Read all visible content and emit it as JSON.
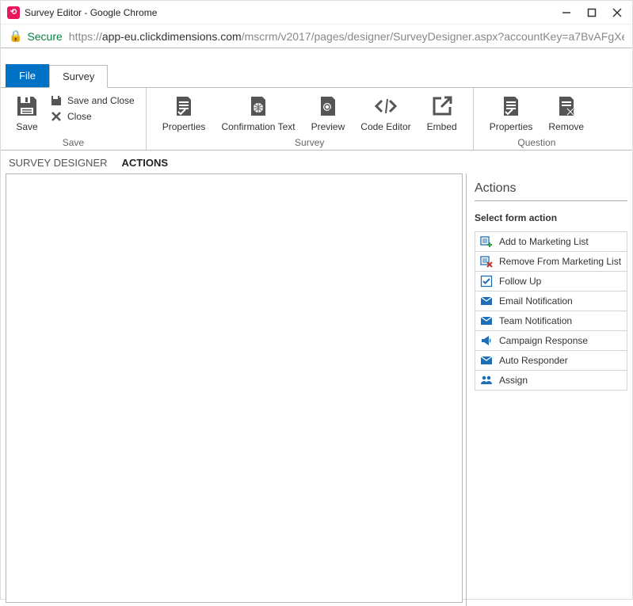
{
  "window": {
    "title": "Survey Editor - Google Chrome",
    "secure_label": "Secure",
    "url_prefix": "https://",
    "url_domain": "app-eu.clickdimensions.com",
    "url_path": "/mscrm/v2017/pages/designer/SurveyDesigner.aspx?accountKey=a7BvAFgXe..."
  },
  "menutabs": {
    "file": "File",
    "survey": "Survey"
  },
  "ribbon": {
    "save": {
      "save": "Save",
      "save_and_close": "Save and Close",
      "close": "Close",
      "group": "Save"
    },
    "survey": {
      "properties": "Properties",
      "confirmation": "Confirmation Text",
      "preview": "Preview",
      "code_editor": "Code Editor",
      "embed": "Embed",
      "group": "Survey"
    },
    "question": {
      "properties": "Properties",
      "remove": "Remove",
      "group": "Question"
    }
  },
  "subtabs": {
    "designer": "SURVEY DESIGNER",
    "actions": "ACTIONS"
  },
  "panel": {
    "title": "Actions",
    "subtitle": "Select form action",
    "items": [
      {
        "label": "Add to Marketing List",
        "icon": "list-add"
      },
      {
        "label": "Remove From Marketing List",
        "icon": "list-remove"
      },
      {
        "label": "Follow Up",
        "icon": "check"
      },
      {
        "label": "Email Notification",
        "icon": "mail"
      },
      {
        "label": "Team Notification",
        "icon": "mail"
      },
      {
        "label": "Campaign Response",
        "icon": "megaphone"
      },
      {
        "label": "Auto Responder",
        "icon": "mail"
      },
      {
        "label": "Assign",
        "icon": "people"
      }
    ]
  }
}
